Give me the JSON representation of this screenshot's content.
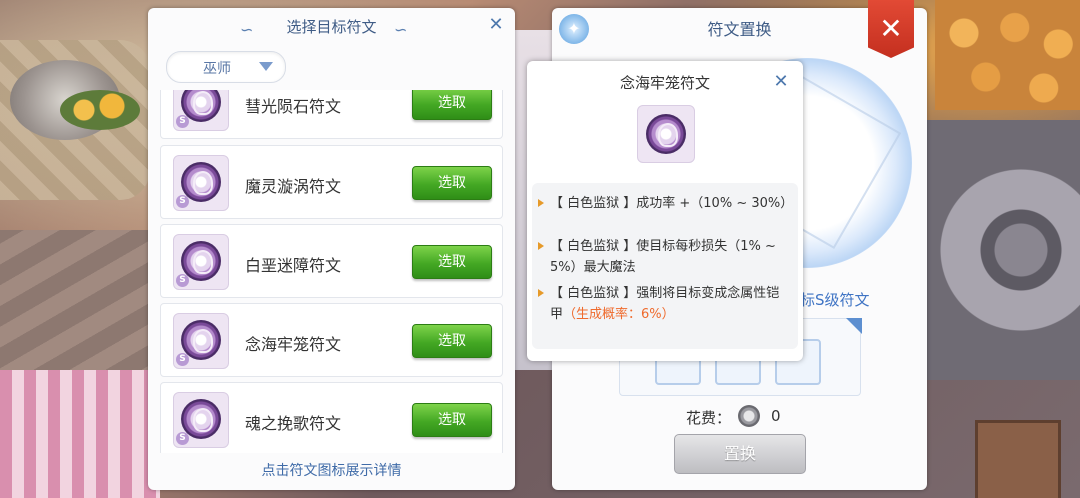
{
  "left_panel": {
    "title": "选择目标符文",
    "filter": {
      "selected": "巫师"
    },
    "select_label": "选取",
    "rows": [
      {
        "name": "彗光陨石符文"
      },
      {
        "name": "魔灵漩涡符文"
      },
      {
        "name": "白垩迷障符文"
      },
      {
        "name": "念海牢笼符文"
      },
      {
        "name": "魂之挽歌符文"
      }
    ],
    "footer_hint": "点击符文图标展示详情"
  },
  "right_panel": {
    "title": "符文置换",
    "sublabel": "标S级符文",
    "cost_label": "花费：",
    "cost_value": "0",
    "exchange_label": "置换"
  },
  "popup": {
    "title": "念海牢笼符文",
    "effects": [
      {
        "text": "【 白色监狱 】成功率 +（10% ~ 30%）"
      },
      {
        "text": "【 白色监狱 】使目标每秒损失（1% ~ 5%）最大魔法"
      },
      {
        "text": "【 白色监狱 】强制将目标变成念属性铠甲",
        "highlight": "（生成概率：6%）"
      }
    ]
  },
  "badge": "S",
  "colors": {
    "accent": "#3f5c86",
    "select_button": "#44a824",
    "highlight": "#ef6a2c",
    "close_banner": "#d43b28"
  }
}
